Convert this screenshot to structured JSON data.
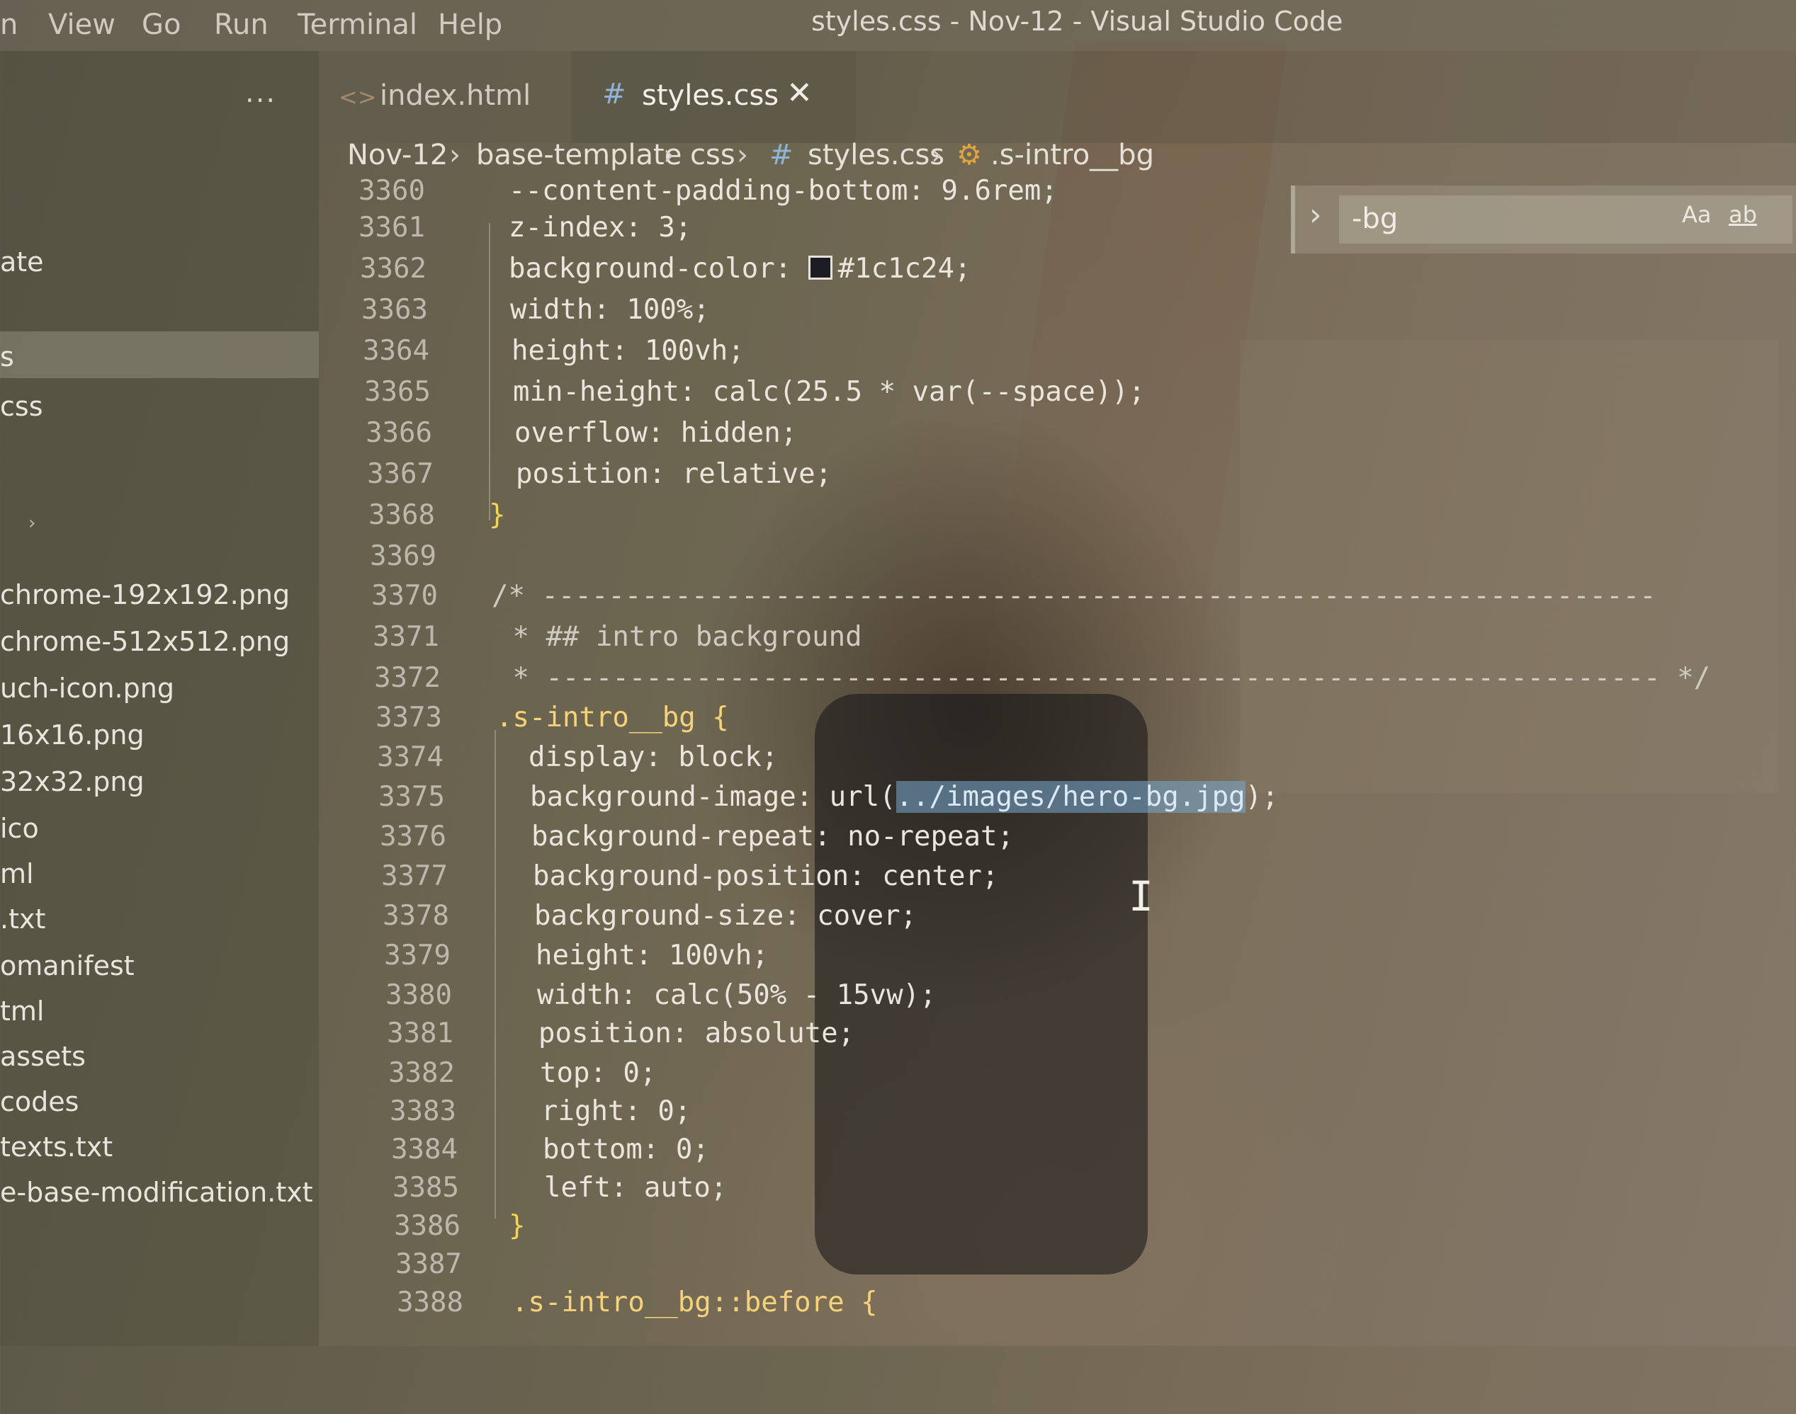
{
  "menu": {
    "items": [
      "n",
      "View",
      "Go",
      "Run",
      "Terminal",
      "Help"
    ],
    "title": "styles.css - Nov-12 - Visual Studio Code"
  },
  "sidebar": {
    "more": "...",
    "items": [
      {
        "label": "ate"
      },
      {
        "label": "s"
      },
      {
        "label": "css"
      },
      {
        "label": "chrome-192x192.png"
      },
      {
        "label": "chrome-512x512.png"
      },
      {
        "label": "uch-icon.png"
      },
      {
        "label": "16x16.png"
      },
      {
        "label": "32x32.png"
      },
      {
        "label": "ico"
      },
      {
        "label": "ml"
      },
      {
        "label": ".txt"
      },
      {
        "label": "omanifest"
      },
      {
        "label": "tml"
      },
      {
        "label": "assets"
      },
      {
        "label": "codes"
      },
      {
        "label": "texts.txt"
      },
      {
        "label": "e-base-modification.txt"
      }
    ]
  },
  "tabs": [
    {
      "label": "index.html",
      "icon": "code-brackets-icon"
    },
    {
      "label": "styles.css",
      "icon": "hash-icon",
      "close": "✕"
    }
  ],
  "breadcrumb": [
    "Nov-12",
    "base-template",
    "css",
    "styles.css",
    ".s-intro__bg"
  ],
  "find": {
    "value": "-bg",
    "match_case": "Aa",
    "whole_word": "ab"
  },
  "editor": {
    "lines": [
      {
        "n": "3360",
        "code": "--content-padding-bottom: 9.6rem;"
      },
      {
        "n": "3361",
        "code": "z-index: 3;"
      },
      {
        "n": "3362",
        "code": "background-color: #1c1c24;"
      },
      {
        "n": "3363",
        "code": "width: 100%;"
      },
      {
        "n": "3364",
        "code": "height: 100vh;"
      },
      {
        "n": "3365",
        "code": "min-height: calc(25.5 * var(--space));"
      },
      {
        "n": "3366",
        "code": "overflow: hidden;"
      },
      {
        "n": "3367",
        "code": "position: relative;"
      },
      {
        "n": "3368",
        "code": "}"
      },
      {
        "n": "3369",
        "code": ""
      },
      {
        "n": "3370",
        "code": "/* -------------------------------------------------------------------"
      },
      {
        "n": "3371",
        "code": " * ## intro background"
      },
      {
        "n": "3372",
        "code": " * ------------------------------------------------------------------- */"
      },
      {
        "n": "3373",
        "code": ".s-intro__bg {"
      },
      {
        "n": "3374",
        "code": "display: block;"
      },
      {
        "n": "3375",
        "code": "background-image: url(../images/hero-bg.jpg);"
      },
      {
        "n": "3376",
        "code": "background-repeat: no-repeat;"
      },
      {
        "n": "3377",
        "code": "background-position: center;"
      },
      {
        "n": "3378",
        "code": "background-size: cover;"
      },
      {
        "n": "3379",
        "code": "height: 100vh;"
      },
      {
        "n": "3380",
        "code": "width: calc(50% - 15vw);"
      },
      {
        "n": "3381",
        "code": "position: absolute;"
      },
      {
        "n": "3382",
        "code": "top: 0;"
      },
      {
        "n": "3383",
        "code": "right: 0;"
      },
      {
        "n": "3384",
        "code": "bottom: 0;"
      },
      {
        "n": "3385",
        "code": "left: auto;"
      },
      {
        "n": "3386",
        "code": "}"
      },
      {
        "n": "3387",
        "code": ""
      },
      {
        "n": "3388",
        "code": ".s-intro__bg::before {"
      }
    ],
    "highlighted_match": "../images/hero-bg.jpg",
    "swatch_color": "#1c1c24"
  },
  "cursor_icon": "text-cursor-icon"
}
